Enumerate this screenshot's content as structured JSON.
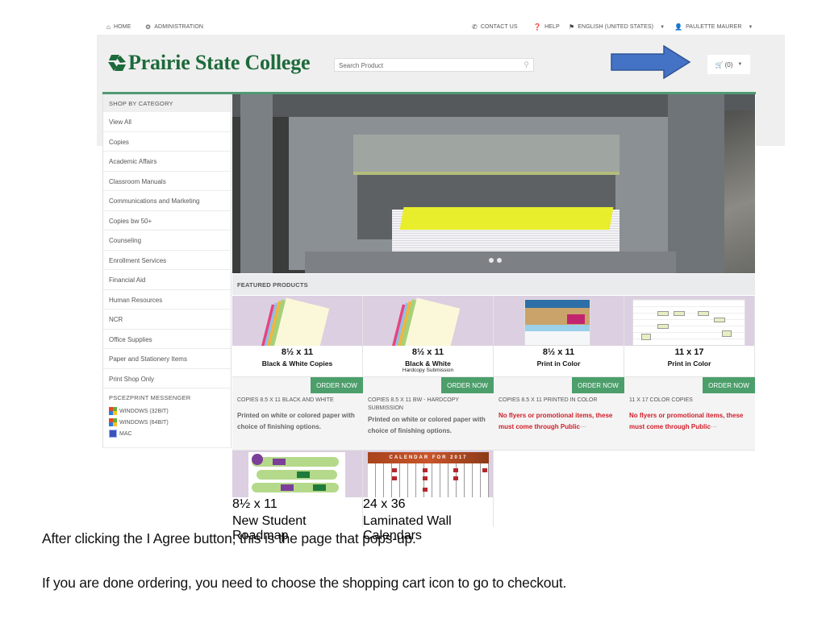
{
  "topbar": {
    "left": [
      {
        "icon": "home-icon",
        "label": "HOME"
      },
      {
        "icon": "gear-icon",
        "label": "ADMINISTRATION"
      }
    ],
    "right": [
      {
        "icon": "phone-icon",
        "label": "CONTACT US"
      },
      {
        "icon": "help-icon",
        "label": "HELP"
      },
      {
        "icon": "flag-icon",
        "label": "ENGLISH (UNITED STATES)"
      },
      {
        "icon": "user-icon",
        "label": "PAULETTE MAURER"
      }
    ]
  },
  "header": {
    "logo_text": "Prairie State College",
    "search_placeholder": "Search Product",
    "cart_label": "(0)",
    "brand_color": "#1d6a3a",
    "accent_green": "#4c9e6b"
  },
  "sidebar": {
    "heading": "SHOP BY CATEGORY",
    "items": [
      "View All",
      "Copies",
      "Academic Affairs",
      "Classroom Manuals",
      "Communications and Marketing",
      "Copies bw 50+",
      "Counseling",
      "Enrollment Services",
      "Financial Aid",
      "Human Resources",
      "NCR",
      "Office Supplies",
      "Paper and Stationery Items",
      "Print Shop Only"
    ],
    "messenger": {
      "title": "PSCEZPRINT MESSENGER",
      "downloads": [
        "WINDOWS (32BIT)",
        "WINDOWS (64BIT)",
        "MAC"
      ]
    }
  },
  "featured": {
    "heading": "FEATURED PRODUCTS",
    "order_label": "ORDER NOW",
    "products": [
      {
        "size": "8½ x 11",
        "name": "Black & White Copies",
        "sub": "",
        "code": "COPIES 8.5 X 11 BLACK AND WHITE",
        "desc": "Printed on white or colored paper with choice of finishing options.",
        "warn": false
      },
      {
        "size": "8½ x 11",
        "name": "Black & White",
        "sub": "Hardcopy Submission",
        "code": "COPIES 8.5 X 11 BW - HARDCOPY SUBMISSION",
        "desc": "Printed on white or colored paper with choice of finishing options.",
        "warn": false
      },
      {
        "size": "8½ x 11",
        "name": "Print in Color",
        "sub": "",
        "code": "COPIES 8.5 X 11 PRINTED IN COLOR",
        "desc": "No flyers or promotional items, these must come through Public",
        "warn": true
      },
      {
        "size": "11 x 17",
        "name": "Print in Color",
        "sub": "",
        "code": "11 X 17 COLOR COPIES",
        "desc": "No flyers or promotional items, these must come through Public",
        "warn": true
      }
    ],
    "products_row2": [
      {
        "size": "8½ x 11",
        "name": "New Student Roadmap"
      },
      {
        "size": "24 x 36",
        "name": "Laminated Wall Calendars",
        "image_title": "CALENDAR FOR 2017"
      }
    ],
    "more_indicator": "···"
  },
  "captions": {
    "line1": "After clicking the I Agree button, this is the page that pops-up.",
    "line2": "If you are done ordering, you need to choose the shopping cart icon to go to checkout."
  }
}
